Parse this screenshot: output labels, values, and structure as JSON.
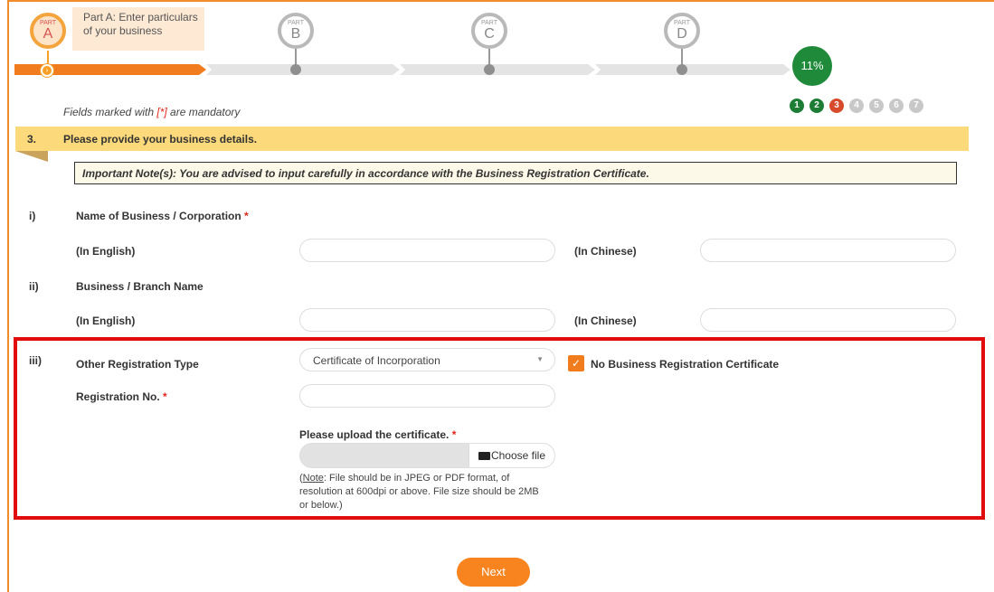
{
  "progress": {
    "parts": [
      {
        "small": "PART",
        "letter": "A"
      },
      {
        "small": "PART",
        "letter": "B"
      },
      {
        "small": "PART",
        "letter": "C"
      },
      {
        "small": "PART",
        "letter": "D"
      }
    ],
    "active_label": "Part A: Enter particulars of your business",
    "percent": "11%",
    "steps": [
      "1",
      "2",
      "3",
      "4",
      "5",
      "6",
      "7"
    ],
    "current_step": 3
  },
  "form": {
    "mandatory_prefix": "Fields marked with ",
    "mandatory_mark": "[*]",
    "mandatory_suffix": " are mandatory",
    "section_number": "3.",
    "section_title": "Please provide your business details.",
    "important_note": "Important Note(s): You are advised to input carefully in accordance with the Business Registration Certificate.",
    "q1_num": "i)",
    "q1_label": "Name of Business / Corporation",
    "q2_num": "ii)",
    "q2_label": "Business / Branch Name",
    "in_english": "(In English)",
    "in_chinese": "(In Chinese)",
    "q3_num": "iii)",
    "q3_label": "Other Registration Type",
    "registration_type_value": "Certificate of Incorporation",
    "no_brc_label": "No Business Registration Certificate",
    "no_brc_checked": true,
    "reg_no_label": "Registration No.",
    "upload_label": "Please upload the certificate.",
    "choose_file_label": "Choose file",
    "upload_note_prefix": "Note",
    "upload_note_text": ": File should be in JPEG or PDF format, of resolution at 600dpi or above. File size should be 2MB or below.)",
    "required_mark": "*",
    "next_label": "Next"
  },
  "colors": {
    "accent_orange": "#f07c1e",
    "complete_green": "#1d7d35",
    "current_red": "#d74a2c",
    "highlight_red": "#e10c0c"
  }
}
